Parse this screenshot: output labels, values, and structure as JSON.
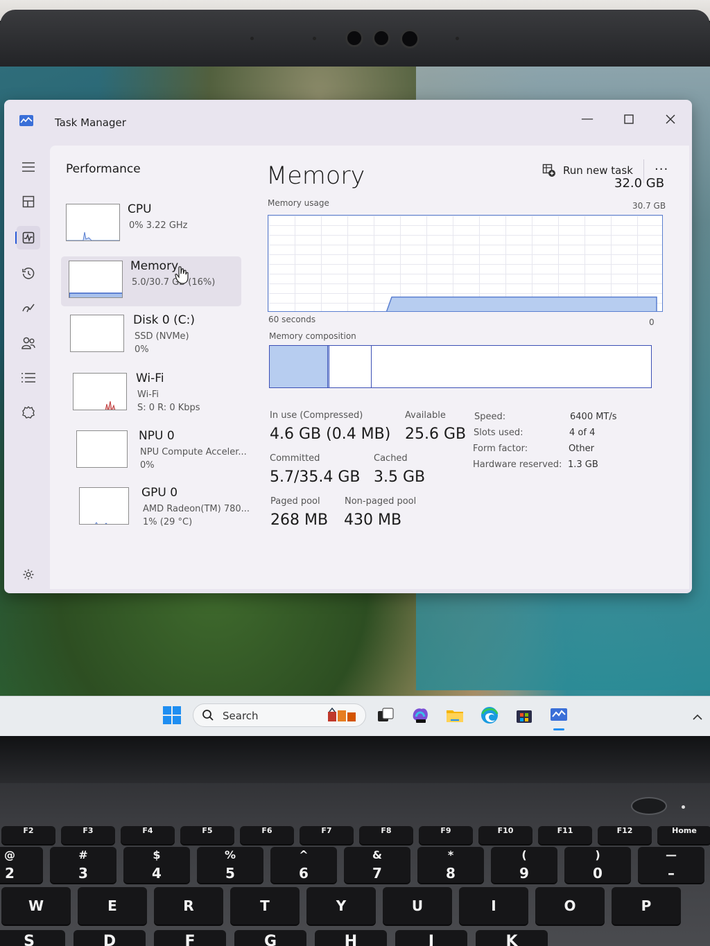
{
  "window": {
    "title": "Task Manager",
    "page_title": "Performance",
    "run_new_task_label": "Run new task",
    "more_label": "···"
  },
  "nav_icons": [
    "hamburger-menu-icon",
    "processes-icon",
    "performance-icon",
    "app-history-icon",
    "startup-apps-icon",
    "users-icon",
    "details-icon",
    "services-icon",
    "settings-icon"
  ],
  "devices": [
    {
      "name": "CPU",
      "line2": "0%  3.22 GHz",
      "line3": ""
    },
    {
      "name": "Memory",
      "line2": "5.0/30.7 GB (16%)",
      "line3": ""
    },
    {
      "name": "Disk 0 (C:)",
      "line2": "SSD (NVMe)",
      "line3": "0%"
    },
    {
      "name": "Wi-Fi",
      "line2": "Wi-Fi",
      "line3": "S: 0 R: 0 Kbps"
    },
    {
      "name": "NPU 0",
      "line2": "NPU Compute Acceler...",
      "line3": "0%"
    },
    {
      "name": "GPU 0",
      "line2": "AMD Radeon(TM) 780...",
      "line3": "1% (29 °C)"
    }
  ],
  "memory": {
    "title": "Memory",
    "total": "32.0 GB",
    "usage_label": "Memory usage",
    "usage_max": "30.7 GB",
    "axis_left": "60 seconds",
    "axis_right": "0",
    "composition_label": "Memory composition",
    "usage_fraction": 0.16
  },
  "stats": {
    "in_use_label": "In use (Compressed)",
    "in_use_value": "4.6 GB (0.4 MB)",
    "available_label": "Available",
    "available_value": "25.6 GB",
    "committed_label": "Committed",
    "committed_value": "5.7/35.4 GB",
    "cached_label": "Cached",
    "cached_value": "3.5 GB",
    "paged_label": "Paged pool",
    "paged_value": "268 MB",
    "nonpaged_label": "Non-paged pool",
    "nonpaged_value": "430 MB"
  },
  "specs": [
    {
      "label": "Speed:",
      "value": "6400 MT/s"
    },
    {
      "label": "Slots used:",
      "value": "4 of 4"
    },
    {
      "label": "Form factor:",
      "value": "Other"
    },
    {
      "label": "Hardware reserved:",
      "value": "1.3 GB"
    }
  ],
  "taskbar": {
    "search_label": "Search"
  },
  "keyboard": {
    "fkeys": [
      "F2",
      "F3",
      "F4",
      "F5",
      "F6",
      "F7",
      "F8",
      "F9",
      "F10",
      "F11",
      "F12",
      "Home"
    ],
    "num_row": [
      {
        "top": "@",
        "bot": "2"
      },
      {
        "top": "#",
        "bot": "3"
      },
      {
        "top": "$",
        "bot": "4"
      },
      {
        "top": "%",
        "bot": "5"
      },
      {
        "top": "^",
        "bot": "6"
      },
      {
        "top": "&",
        "bot": "7"
      },
      {
        "top": "*",
        "bot": "8"
      },
      {
        "top": "(",
        "bot": "9"
      },
      {
        "top": ")",
        "bot": "0"
      },
      {
        "top": "—",
        "bot": "–"
      }
    ],
    "letter_row_1": [
      "W",
      "E",
      "R",
      "T",
      "Y",
      "U",
      "I",
      "O",
      "P"
    ],
    "letter_row_2": [
      "S",
      "D",
      "F",
      "G",
      "H",
      "J",
      "K"
    ]
  },
  "colors": {
    "accent": "#2a5bd7",
    "graph_fill": "#b7cdf0",
    "graph_line": "#5a7fd0",
    "window_bg": "#e9e5ef",
    "content_bg": "#f3f1f6"
  }
}
